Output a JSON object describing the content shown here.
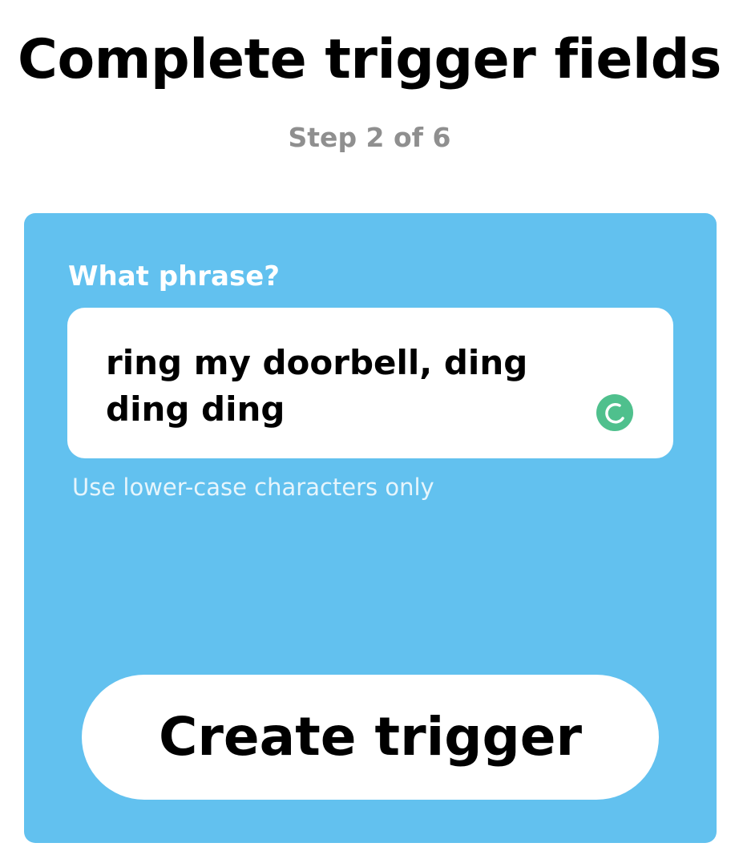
{
  "header": {
    "title": "Complete trigger fields",
    "step": "Step 2 of 6"
  },
  "form": {
    "background_color": "#62c1ef",
    "field_label": "What phrase?",
    "phrase_value": "ring my doorbell, ding ding ding",
    "helper_text": "Use lower-case characters only",
    "input_status_icon": "grammar-check-icon",
    "input_status_icon_color": "#4fc08d"
  },
  "actions": {
    "create_label": "Create trigger"
  }
}
